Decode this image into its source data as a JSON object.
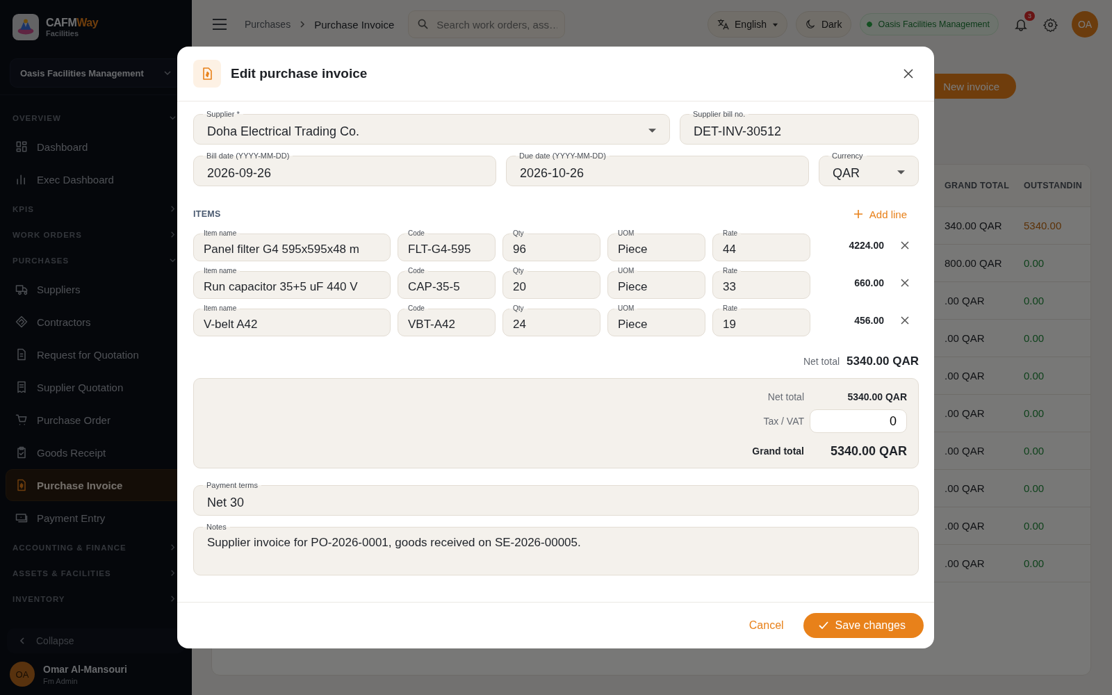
{
  "sidebar": {
    "brand": {
      "name_first": "CAFM",
      "name_second": "Way",
      "subtitle": "Facilities"
    },
    "org_selector": "Oasis Facilities Management",
    "sections": [
      {
        "title": "OVERVIEW",
        "expanded": true,
        "items": [
          {
            "label": "Dashboard",
            "selected": false
          },
          {
            "label": "Exec Dashboard",
            "selected": false
          }
        ]
      },
      {
        "title": "KPIS",
        "expanded": false
      },
      {
        "title": "WORK ORDERS",
        "expanded": false
      },
      {
        "title": "PURCHASES",
        "expanded": true,
        "items": [
          {
            "label": "Suppliers",
            "selected": false
          },
          {
            "label": "Contractors",
            "selected": false
          },
          {
            "label": "Request for Quotation",
            "selected": false
          },
          {
            "label": "Supplier Quotation",
            "selected": false
          },
          {
            "label": "Purchase Order",
            "selected": false
          },
          {
            "label": "Goods Receipt",
            "selected": false
          },
          {
            "label": "Purchase Invoice",
            "selected": true
          },
          {
            "label": "Payment Entry",
            "selected": false
          }
        ]
      },
      {
        "title": "ACCOUNTING & FINANCE",
        "expanded": false
      },
      {
        "title": "ASSETS & FACILITIES",
        "expanded": false
      },
      {
        "title": "INVENTORY",
        "expanded": false
      }
    ],
    "collapse": "Collapse",
    "user": {
      "initials": "OA",
      "name": "Omar Al-Mansouri",
      "role": "Fm Admin"
    }
  },
  "topbar": {
    "breadcrumb": [
      "Purchases",
      "Purchase Invoice"
    ],
    "search": {
      "placeholder": "Search work orders, ass…"
    },
    "language": "English",
    "theme": "Dark",
    "organization": "Oasis Facilities Management",
    "notifications": "3",
    "avatar": "OA"
  },
  "page": {
    "new_button": "New invoice",
    "table": {
      "columns": [
        "GRAND TOTAL",
        "OUTSTANDIN"
      ],
      "rows": [
        {
          "grand_total": "340.00 QAR",
          "outstanding": "5340.00",
          "kind": "open"
        },
        {
          "grand_total": "800.00 QAR",
          "outstanding": "0.00",
          "kind": "settled"
        },
        {
          "grand_total": ".00 QAR",
          "outstanding": "0.00",
          "kind": "settled"
        },
        {
          "grand_total": ".00 QAR",
          "outstanding": "0.00",
          "kind": "settled"
        },
        {
          "grand_total": ".00 QAR",
          "outstanding": "0.00",
          "kind": "settled"
        },
        {
          "grand_total": ".00 QAR",
          "outstanding": "0.00",
          "kind": "settled"
        },
        {
          "grand_total": ".00 QAR",
          "outstanding": "0.00",
          "kind": "settled"
        },
        {
          "grand_total": ".00 QAR",
          "outstanding": "0.00",
          "kind": "settled"
        },
        {
          "grand_total": ".00 QAR",
          "outstanding": "0.00",
          "kind": "settled"
        },
        {
          "grand_total": ".00 QAR",
          "outstanding": "0.00",
          "kind": "settled"
        }
      ]
    }
  },
  "dialog": {
    "title": "Edit purchase invoice",
    "supplier": {
      "label": "Supplier *",
      "value": "Doha Electrical Trading Co."
    },
    "bill_no": {
      "label": "Supplier bill no.",
      "value": "DET-INV-30512"
    },
    "bill_date": {
      "label": "Bill date (YYYY-MM-DD)",
      "value": "2026-09-26"
    },
    "due_date": {
      "label": "Due date (YYYY-MM-DD)",
      "value": "2026-10-26"
    },
    "currency": {
      "label": "Currency",
      "value": "QAR"
    },
    "items_heading": "ITEMS",
    "add_line": "Add line",
    "items": [
      {
        "fields": [
          {
            "label": "Item name",
            "value": "Panel filter G4 595x595x48 m"
          },
          {
            "label": "Code",
            "value": "FLT-G4-595"
          },
          {
            "label": "Qty",
            "value": "96"
          },
          {
            "label": "UOM",
            "value": "Piece"
          },
          {
            "label": "Rate",
            "value": "44"
          }
        ],
        "amount": "4224.00"
      },
      {
        "fields": [
          {
            "label": "Item name",
            "value": "Run capacitor 35+5 uF 440 V"
          },
          {
            "label": "Code",
            "value": "CAP-35-5"
          },
          {
            "label": "Qty",
            "value": "20"
          },
          {
            "label": "UOM",
            "value": "Piece"
          },
          {
            "label": "Rate",
            "value": "33"
          }
        ],
        "amount": "660.00"
      },
      {
        "fields": [
          {
            "label": "Item name",
            "value": "V-belt A42"
          },
          {
            "label": "Code",
            "value": "VBT-A42"
          },
          {
            "label": "Qty",
            "value": "24"
          },
          {
            "label": "UOM",
            "value": "Piece"
          },
          {
            "label": "Rate",
            "value": "19"
          }
        ],
        "amount": "456.00"
      }
    ],
    "net_total_label": "Net total",
    "net_total": "5340.00 QAR",
    "summary": {
      "net_label": "Net total",
      "net_value": "5340.00 QAR",
      "tax_label": "Tax / VAT",
      "tax_value": "0",
      "grand_label": "Grand total",
      "grand_value": "5340.00 QAR"
    },
    "payment_terms": {
      "label": "Payment terms",
      "value": "Net 30"
    },
    "notes": {
      "label": "Notes",
      "value": "Supplier invoice for PO-2026-0001, goods received on SE-2026-00005."
    },
    "cancel": "Cancel",
    "save": "Save changes"
  }
}
